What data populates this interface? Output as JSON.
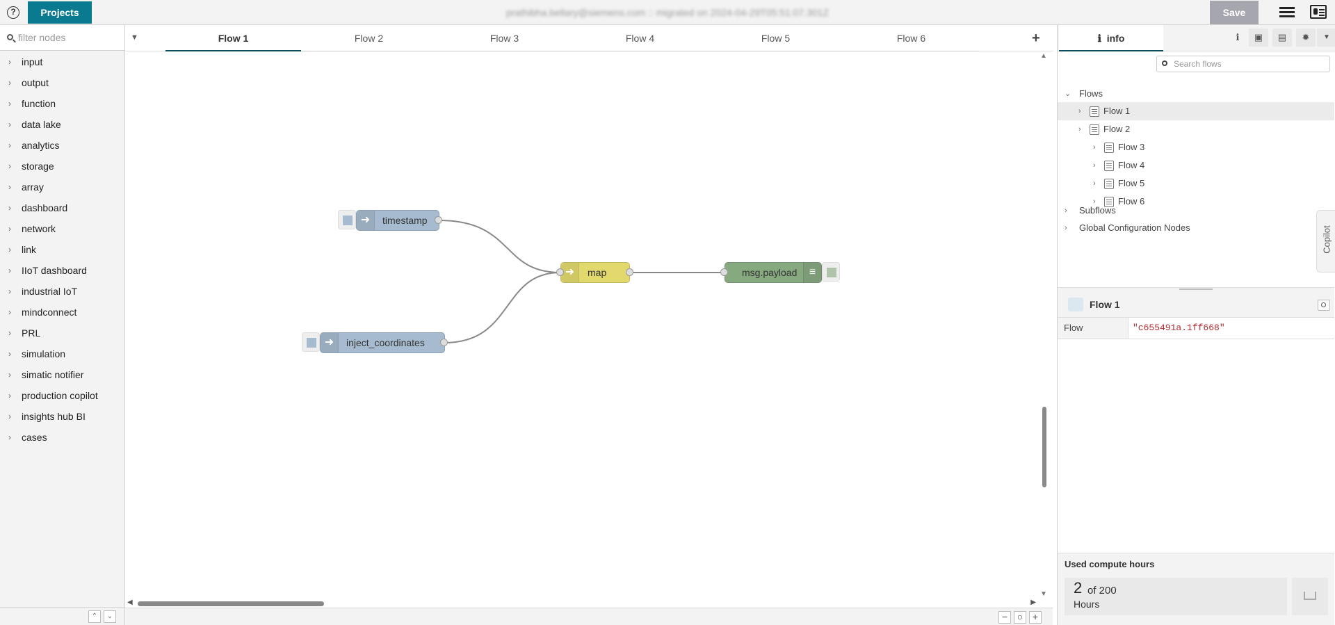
{
  "header": {
    "help_icon": "question-circle-icon",
    "projects_label": "Projects",
    "title": "prathibha.bellary@siemens.com :: migrated on 2024-04-29T05:51:07.301Z",
    "save_label": "Save",
    "accent_color": "#0a7a90"
  },
  "palette": {
    "search_placeholder": "filter nodes",
    "categories": [
      "input",
      "output",
      "function",
      "data lake",
      "analytics",
      "storage",
      "array",
      "dashboard",
      "network",
      "link",
      "IIoT dashboard",
      "industrial IoT",
      "mindconnect",
      "PRL",
      "simulation",
      "simatic notifier",
      "production copilot",
      "insights hub BI",
      "cases"
    ]
  },
  "workspace": {
    "tabs": [
      "Flow 1",
      "Flow 2",
      "Flow 3",
      "Flow 4",
      "Flow 5",
      "Flow 6"
    ],
    "active_tab": "Flow 1",
    "nodes": {
      "timestamp": "timestamp",
      "inject_coordinates": "inject_coordinates",
      "map": "map",
      "debug": "msg.payload"
    },
    "node_colors": {
      "inject": "#a6bbcf",
      "function": "#e2d96e",
      "debug": "#87a980"
    }
  },
  "sidebar": {
    "active_tab_label": "info",
    "search_placeholder": "Search flows",
    "tree": {
      "flows_label": "Flows",
      "flows": [
        "Flow 1",
        "Flow 2",
        "Flow 3",
        "Flow 4",
        "Flow 5",
        "Flow 6"
      ],
      "subflows_label": "Subflows",
      "global_config_label": "Global Configuration Nodes"
    },
    "copilot_label": "Copilot",
    "properties": {
      "title": "Flow 1",
      "key": "Flow",
      "value": "\"c655491a.1ff668\""
    },
    "compute": {
      "title": "Used compute hours",
      "used": "2",
      "of_total": "of 200",
      "unit": "Hours"
    }
  }
}
